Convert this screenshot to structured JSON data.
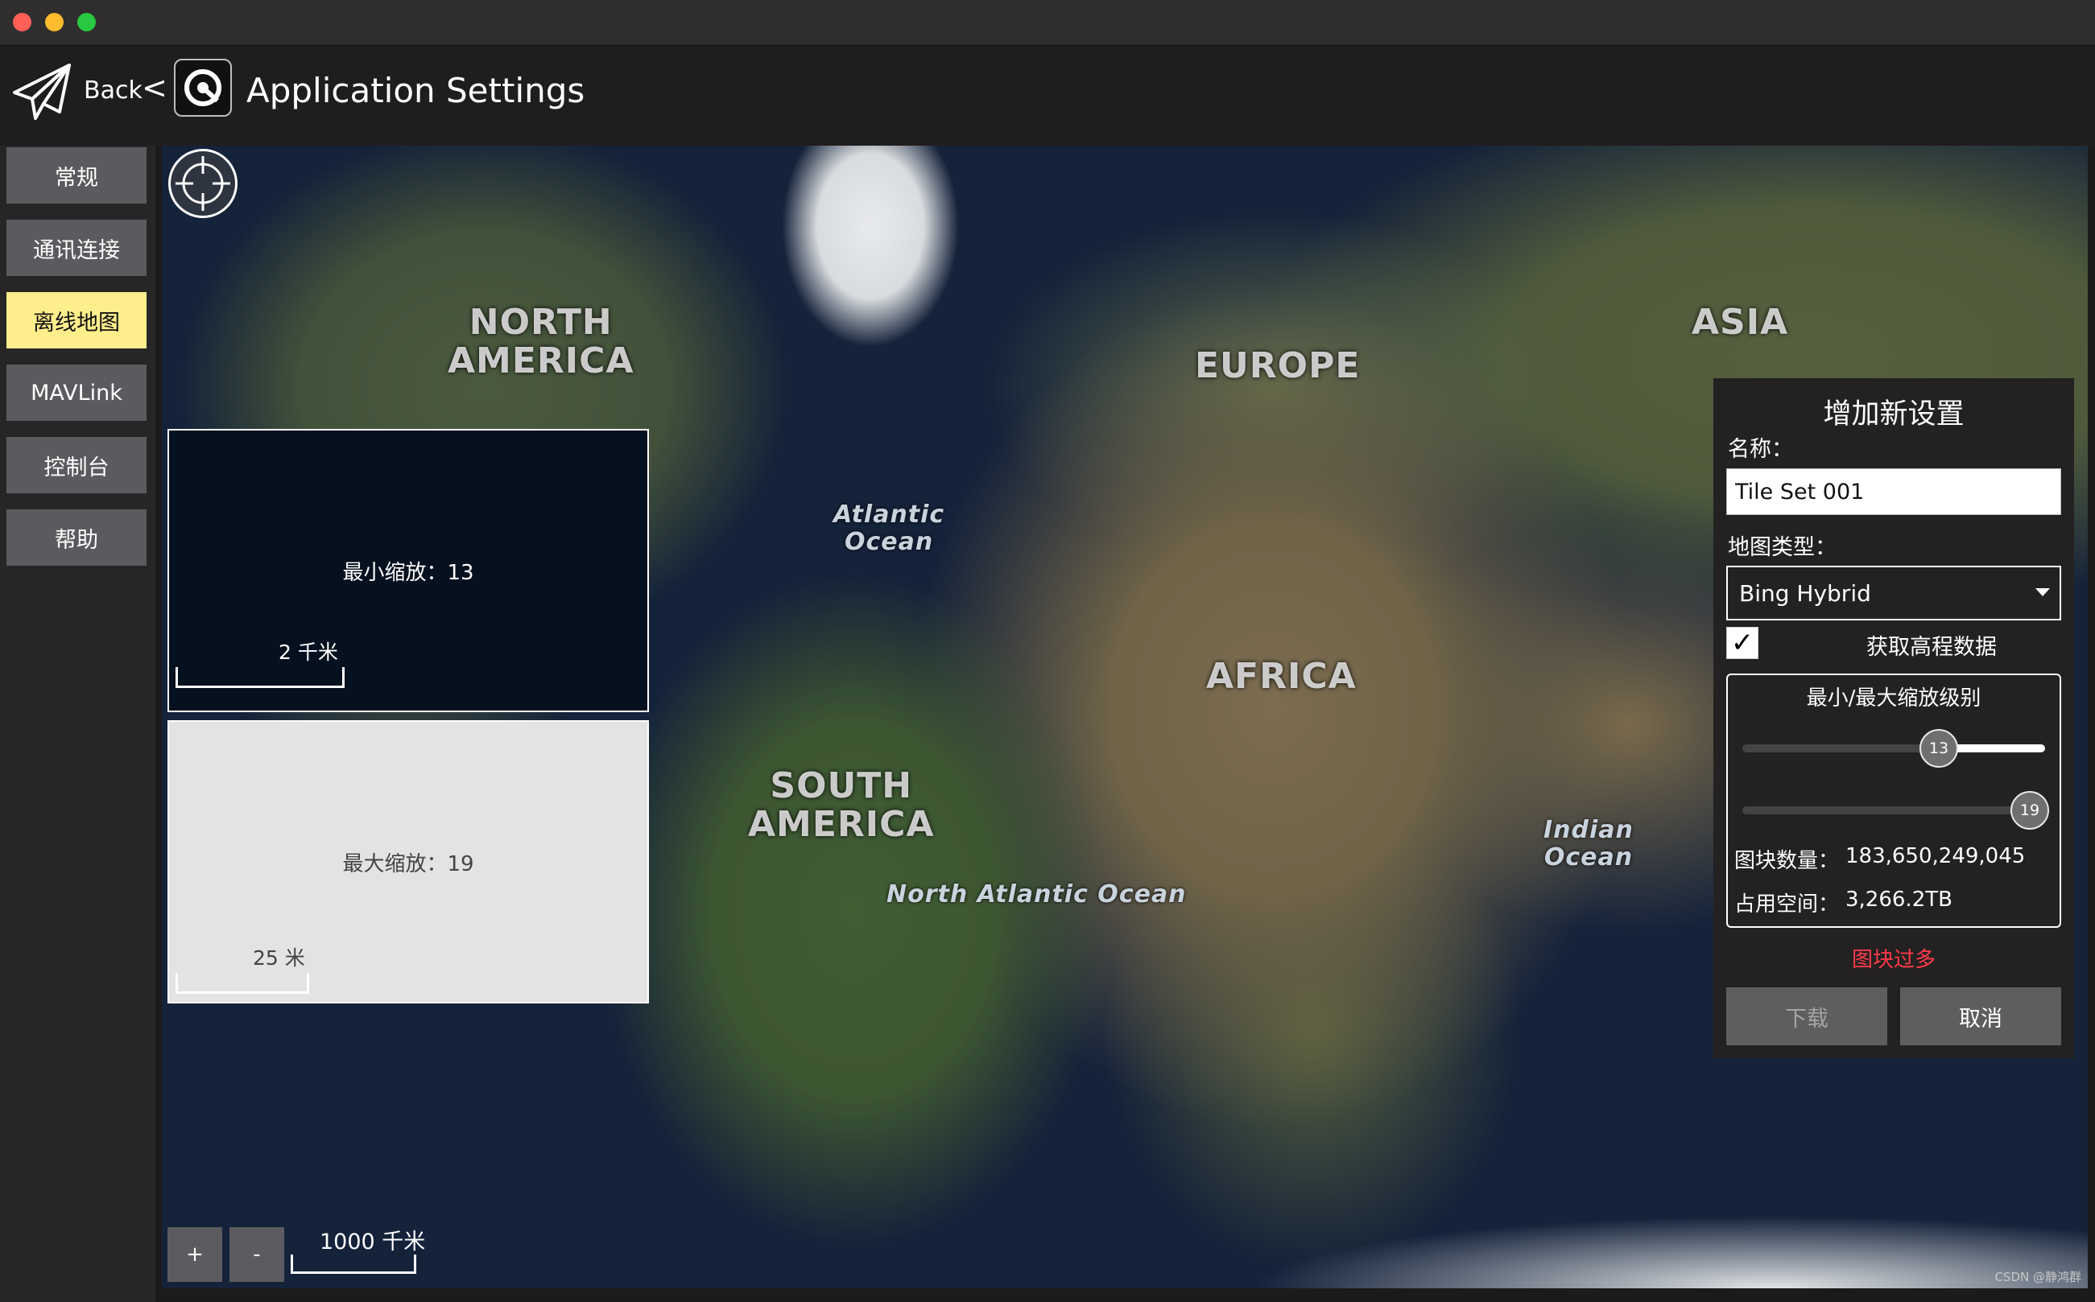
{
  "window": {
    "controls": [
      "close",
      "minimize",
      "zoom"
    ]
  },
  "header": {
    "back_label": "Back",
    "separator": "<",
    "title": "Application Settings",
    "back_icon": "paper-plane-icon",
    "app_icon": "app-logo-icon"
  },
  "sidebar": {
    "items": [
      {
        "label": "常规",
        "active": false
      },
      {
        "label": "通讯连接",
        "active": false
      },
      {
        "label": "离线地图",
        "active": true
      },
      {
        "label": "MAVLink",
        "active": false
      },
      {
        "label": "控制台",
        "active": false
      },
      {
        "label": "帮助",
        "active": false
      }
    ],
    "active_color": "#ffee8c"
  },
  "map": {
    "labels": {
      "north_america": "NORTH\nAMERICA",
      "europe": "EUROPE",
      "asia": "ASIA",
      "africa": "AFRICA",
      "south_america": "SOUTH\nAMERICA",
      "atlantic": "Atlantic\nOcean",
      "north_atlantic": "North Atlantic Ocean",
      "indian": "Indian\nOcean"
    },
    "min_preview": {
      "label": "最小缩放：13",
      "scale": "2 千米"
    },
    "max_preview": {
      "label": "最大缩放：19",
      "scale": "25 米"
    },
    "zoom_in": "+",
    "zoom_out": "-",
    "scale": "1000 千米",
    "watermark": "CSDN @静鸿群",
    "locate_icon": "crosshair-icon"
  },
  "panel": {
    "title": "增加新设置",
    "name_label": "名称：",
    "name_value": "Tile Set 001",
    "map_type_label": "地图类型：",
    "map_type_value": "Bing Hybrid",
    "elevation_checked": true,
    "elevation_label": "获取高程数据",
    "zoom_title": "最小/最大缩放级别",
    "min_zoom": 13,
    "max_zoom": 19,
    "zoom_range_max": 20,
    "tile_count_label": "图块数量：",
    "tile_count": "183,650,249,045",
    "size_label": "占用空间：",
    "size": "3,266.2TB",
    "warning": "图块过多",
    "warning_color": "#ff3a4a",
    "download_label": "下载",
    "cancel_label": "取消"
  }
}
